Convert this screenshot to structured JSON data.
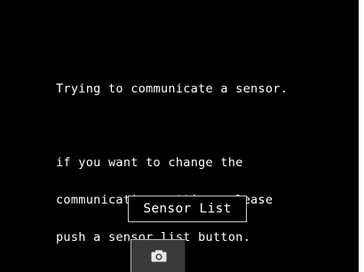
{
  "message": {
    "line1": "Trying to communicate a sensor.",
    "lines": [
      "if you want to change the",
      "communication setting, please",
      "push a sensor list button."
    ]
  },
  "buttons": {
    "sensor_list_label": "Sensor List",
    "capture_icon": "camera-icon"
  },
  "colors": {
    "background": "#000000",
    "text": "#ffffff",
    "button_border": "#c8c8c8",
    "capture_button_bg": "#3a3a3a"
  }
}
